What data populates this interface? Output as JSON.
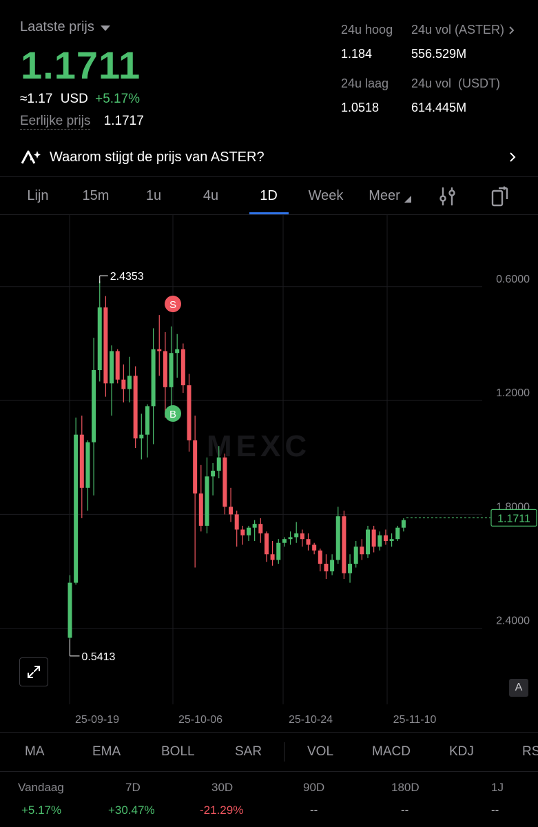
{
  "header": {
    "last_price_label": "Laatste prijs",
    "last_price": "1.1711",
    "approx": "≈1.17",
    "currency": "USD",
    "change": "+5.17%",
    "fair_price_label": "Eerlijke prijs",
    "fair_price": "1.1717"
  },
  "stats": {
    "high_label": "24u hoog",
    "high_value": "1.184",
    "vol_base_label": "24u vol (ASTER)",
    "vol_base_value": "556.529M",
    "low_label": "24u laag",
    "low_value": "1.0518",
    "vol_quote_label": "24u vol  (USDT)",
    "vol_quote_value": "614.445M"
  },
  "banner": {
    "text": "Waarom stijgt de prijs van ASTER?"
  },
  "tabs": [
    "Lijn",
    "15m",
    "1u",
    "4u",
    "1D",
    "Week",
    "Meer"
  ],
  "active_tab": "1D",
  "chart": {
    "watermark": "MEXC",
    "y_ticks": [
      "2.4000",
      "1.8000",
      "1.2000",
      "0.6000"
    ],
    "x_ticks": [
      "25-09-19",
      "25-10-06",
      "25-10-24",
      "25-11-10"
    ],
    "max_label": "2.4353",
    "min_label": "0.5413",
    "current_price_tag": "1.1711",
    "sell_marker": "S",
    "buy_marker": "B",
    "auto_button": "A"
  },
  "chart_data": {
    "type": "candlestick",
    "y_ticks": [
      0.6,
      1.2,
      1.8,
      2.4
    ],
    "x_ticks": [
      "25-09-19",
      "25-10-06",
      "25-10-24",
      "25-11-10"
    ],
    "max": 2.4353,
    "min": 0.5413,
    "last": 1.1711,
    "candles": [
      {
        "o": 0.55,
        "h": 0.88,
        "l": 0.54,
        "c": 0.84
      },
      {
        "o": 0.84,
        "h": 1.71,
        "l": 0.83,
        "c": 1.62
      },
      {
        "o": 1.62,
        "h": 1.72,
        "l": 1.18,
        "c": 1.34
      },
      {
        "o": 1.34,
        "h": 1.59,
        "l": 1.22,
        "c": 1.58
      },
      {
        "o": 1.58,
        "h": 2.13,
        "l": 1.3,
        "c": 1.96
      },
      {
        "o": 1.96,
        "h": 2.43,
        "l": 1.9,
        "c": 2.29
      },
      {
        "o": 2.29,
        "h": 2.35,
        "l": 1.82,
        "c": 1.89
      },
      {
        "o": 1.89,
        "h": 2.09,
        "l": 1.72,
        "c": 2.06
      },
      {
        "o": 2.06,
        "h": 2.07,
        "l": 1.89,
        "c": 1.91
      },
      {
        "o": 1.91,
        "h": 1.99,
        "l": 1.79,
        "c": 1.86
      },
      {
        "o": 1.86,
        "h": 2.03,
        "l": 1.79,
        "c": 1.93
      },
      {
        "o": 1.93,
        "h": 1.98,
        "l": 1.55,
        "c": 1.6
      },
      {
        "o": 1.6,
        "h": 1.73,
        "l": 1.49,
        "c": 1.62
      },
      {
        "o": 1.62,
        "h": 1.78,
        "l": 1.5,
        "c": 1.77
      },
      {
        "o": 1.77,
        "h": 2.18,
        "l": 1.57,
        "c": 2.07
      },
      {
        "o": 2.07,
        "h": 2.25,
        "l": 1.93,
        "c": 2.06
      },
      {
        "o": 2.06,
        "h": 2.16,
        "l": 1.71,
        "c": 1.87
      },
      {
        "o": 1.87,
        "h": 2.19,
        "l": 1.72,
        "c": 2.05
      },
      {
        "o": 2.05,
        "h": 2.15,
        "l": 1.92,
        "c": 2.07
      },
      {
        "o": 2.07,
        "h": 2.1,
        "l": 1.84,
        "c": 1.88
      },
      {
        "o": 1.88,
        "h": 1.94,
        "l": 1.53,
        "c": 1.59
      },
      {
        "o": 1.59,
        "h": 1.72,
        "l": 0.92,
        "c": 1.31
      },
      {
        "o": 1.31,
        "h": 1.46,
        "l": 1.11,
        "c": 1.14
      },
      {
        "o": 1.14,
        "h": 1.5,
        "l": 1.1,
        "c": 1.4
      },
      {
        "o": 1.4,
        "h": 1.47,
        "l": 1.3,
        "c": 1.43
      },
      {
        "o": 1.43,
        "h": 1.56,
        "l": 1.39,
        "c": 1.5
      },
      {
        "o": 1.5,
        "h": 1.52,
        "l": 1.2,
        "c": 1.24
      },
      {
        "o": 1.24,
        "h": 1.34,
        "l": 1.16,
        "c": 1.2
      },
      {
        "o": 1.2,
        "h": 1.22,
        "l": 1.03,
        "c": 1.12
      },
      {
        "o": 1.12,
        "h": 1.14,
        "l": 1.04,
        "c": 1.09
      },
      {
        "o": 1.09,
        "h": 1.14,
        "l": 1.06,
        "c": 1.13
      },
      {
        "o": 1.13,
        "h": 1.17,
        "l": 1.06,
        "c": 1.15
      },
      {
        "o": 1.15,
        "h": 1.18,
        "l": 1.05,
        "c": 1.1
      },
      {
        "o": 1.1,
        "h": 1.11,
        "l": 0.95,
        "c": 0.99
      },
      {
        "o": 0.99,
        "h": 1.06,
        "l": 0.93,
        "c": 0.96
      },
      {
        "o": 0.96,
        "h": 1.07,
        "l": 0.94,
        "c": 1.05
      },
      {
        "o": 1.05,
        "h": 1.08,
        "l": 1.03,
        "c": 1.07
      },
      {
        "o": 1.07,
        "h": 1.11,
        "l": 1.04,
        "c": 1.08
      },
      {
        "o": 1.08,
        "h": 1.16,
        "l": 1.05,
        "c": 1.1
      },
      {
        "o": 1.1,
        "h": 1.12,
        "l": 1.03,
        "c": 1.07
      },
      {
        "o": 1.07,
        "h": 1.1,
        "l": 1.01,
        "c": 1.04
      },
      {
        "o": 1.04,
        "h": 1.05,
        "l": 0.99,
        "c": 1.01
      },
      {
        "o": 1.01,
        "h": 1.02,
        "l": 0.9,
        "c": 0.94
      },
      {
        "o": 0.94,
        "h": 0.99,
        "l": 0.86,
        "c": 0.9
      },
      {
        "o": 0.9,
        "h": 0.99,
        "l": 0.88,
        "c": 0.96
      },
      {
        "o": 0.96,
        "h": 1.24,
        "l": 0.94,
        "c": 1.19
      },
      {
        "o": 1.19,
        "h": 1.22,
        "l": 0.86,
        "c": 0.89
      },
      {
        "o": 0.89,
        "h": 0.99,
        "l": 0.84,
        "c": 0.94
      },
      {
        "o": 0.94,
        "h": 1.06,
        "l": 0.92,
        "c": 1.03
      },
      {
        "o": 1.03,
        "h": 1.07,
        "l": 0.96,
        "c": 0.99
      },
      {
        "o": 0.99,
        "h": 1.14,
        "l": 0.97,
        "c": 1.12
      },
      {
        "o": 1.12,
        "h": 1.14,
        "l": 1.0,
        "c": 1.03
      },
      {
        "o": 1.03,
        "h": 1.11,
        "l": 1.01,
        "c": 1.09
      },
      {
        "o": 1.09,
        "h": 1.12,
        "l": 1.04,
        "c": 1.06
      },
      {
        "o": 1.06,
        "h": 1.1,
        "l": 1.03,
        "c": 1.07
      },
      {
        "o": 1.07,
        "h": 1.14,
        "l": 1.06,
        "c": 1.13
      },
      {
        "o": 1.13,
        "h": 1.18,
        "l": 1.11,
        "c": 1.17
      }
    ]
  },
  "indicators": [
    "MA",
    "EMA",
    "BOLL",
    "SAR",
    "VOL",
    "MACD",
    "KDJ",
    "RS"
  ],
  "periods": [
    {
      "label": "Vandaag",
      "value": "+5.17%",
      "tone": "green"
    },
    {
      "label": "7D",
      "value": "+30.47%",
      "tone": "green"
    },
    {
      "label": "30D",
      "value": "-21.29%",
      "tone": "red"
    },
    {
      "label": "90D",
      "value": "--",
      "tone": "muted"
    },
    {
      "label": "180D",
      "value": "--",
      "tone": "muted"
    },
    {
      "label": "1J",
      "value": "--",
      "tone": "muted"
    }
  ],
  "colors": {
    "up": "#4cbf6e",
    "down": "#f0565f",
    "accent": "#2f73e8"
  }
}
